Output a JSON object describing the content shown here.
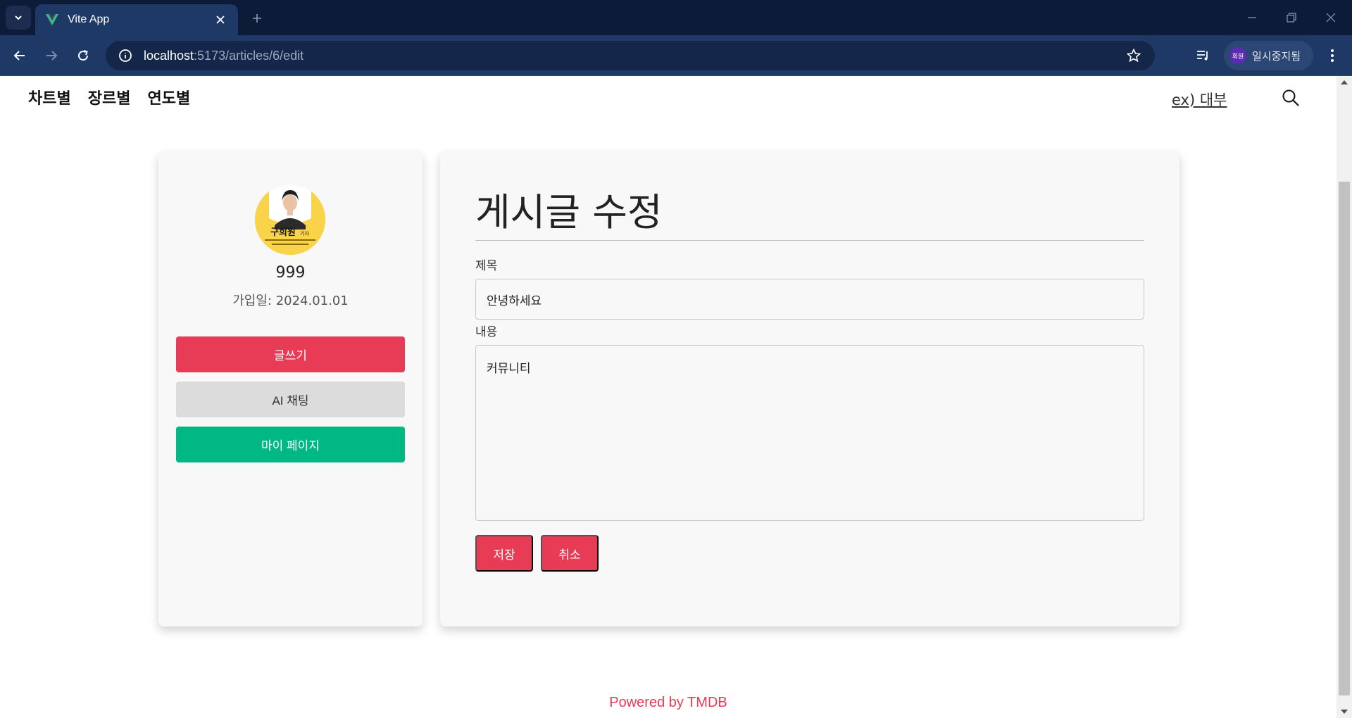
{
  "browser": {
    "tab_title": "Vite App",
    "url_host": "localhost",
    "url_rest": ":5173/articles/6/edit",
    "profile_avatar_text": "회원",
    "profile_status": "일시중지됨",
    "colors": {
      "chrome_bg": "#0b1b38",
      "toolbar_bg": "#1e3966"
    }
  },
  "header": {
    "nav": [
      "차트별",
      "장르별",
      "연도별"
    ],
    "search_hint": "ex) 대부"
  },
  "profile": {
    "avatar_caption": "구희원",
    "avatar_caption_suffix": "기자",
    "username": "999",
    "joined": "가입일: 2024.01.01",
    "buttons": {
      "write": "글쓰기",
      "ai_chat": "AI 채팅",
      "mypage": "마이 페이지"
    }
  },
  "edit": {
    "heading": "게시글 수정",
    "title_label": "제목",
    "title_value": "안녕하세요",
    "content_label": "내용",
    "content_value": "커뮤니티",
    "save": "저장",
    "cancel": "취소"
  },
  "footer": {
    "text": "Powered by TMDB"
  },
  "colors": {
    "accent": "#e83b55",
    "green": "#00b884",
    "gray_button": "#dcdcdc"
  }
}
